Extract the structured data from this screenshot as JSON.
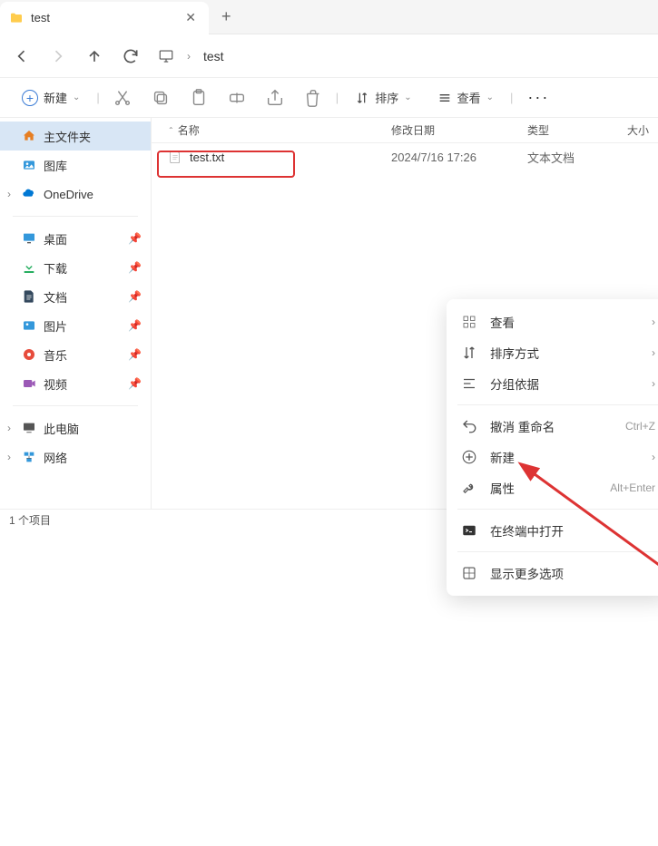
{
  "tab": {
    "title": "test"
  },
  "breadcrumb": {
    "current": "test"
  },
  "toolbar": {
    "new_label": "新建",
    "sort_label": "排序",
    "view_label": "查看"
  },
  "columns": {
    "name": "名称",
    "modified": "修改日期",
    "type": "类型",
    "size": "大小"
  },
  "files": [
    {
      "name": "test.txt",
      "date": "2024/7/16 17:26",
      "type": "文本文档"
    }
  ],
  "sidebar": {
    "home": "主文件夹",
    "gallery": "图库",
    "onedrive": "OneDrive",
    "desktop": "桌面",
    "downloads": "下载",
    "documents": "文档",
    "pictures": "图片",
    "music": "音乐",
    "videos": "视频",
    "thispc": "此电脑",
    "network": "网络"
  },
  "context_menu": {
    "view": "查看",
    "sort": "排序方式",
    "group": "分组依据",
    "undo": "撤消 重命名",
    "undo_sc": "Ctrl+Z",
    "new": "新建",
    "properties": "属性",
    "properties_sc": "Alt+Enter",
    "terminal": "在终端中打开",
    "more": "显示更多选项"
  },
  "status": {
    "text": "1 个项目"
  }
}
